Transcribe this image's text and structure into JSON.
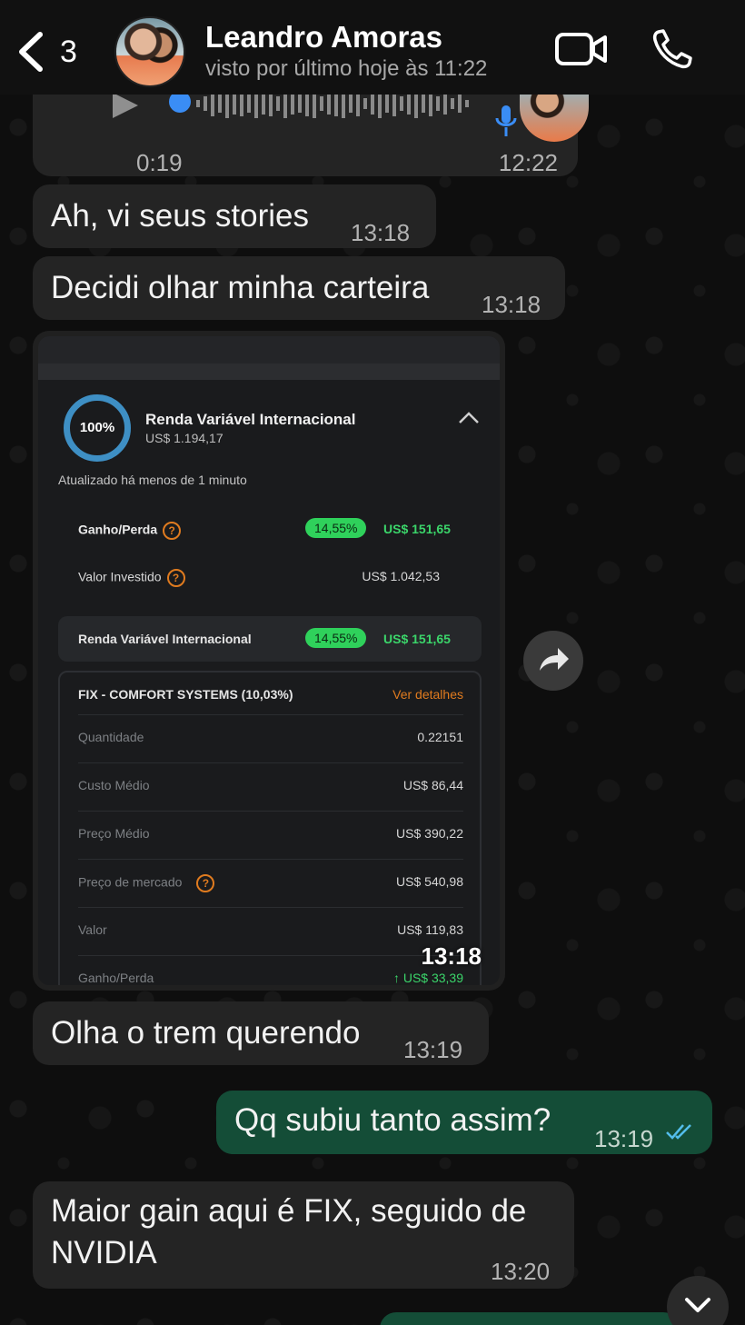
{
  "header": {
    "back_count": "3",
    "contact_name": "Leandro Amoras",
    "status": "visto por último hoje às 11:22"
  },
  "voice_message": {
    "duration": "0:19",
    "time": "12:22"
  },
  "messages": [
    {
      "text": "Ah, vi seus stories",
      "time": "13:18",
      "direction": "in"
    },
    {
      "text": "Decidi olhar minha carteira",
      "time": "13:18",
      "direction": "in"
    },
    {
      "text": "Olha o trem querendo",
      "time": "13:19",
      "direction": "in"
    },
    {
      "text": "Qq subiu tanto assim?",
      "time": "13:19",
      "direction": "out"
    },
    {
      "text": "Maior gain aqui é FIX, seguido de NVIDIA",
      "time": "13:20",
      "direction": "in"
    }
  ],
  "screenshot": {
    "time": "13:18",
    "ring_pct": "100%",
    "title": "Renda Variável Internacional",
    "total": "US$ 1.194,17",
    "updated": "Atualizado há menos de 1 minuto",
    "gain_label": "Ganho/Perda",
    "gain_pct": "14,55%",
    "gain_val": "US$ 151,65",
    "invested_label": "Valor Investido",
    "invested_val": "US$ 1.042,53",
    "summary_label": "Renda Variável Internacional",
    "summary_pct": "14,55%",
    "summary_val": "US$ 151,65",
    "detail_title": "FIX - COMFORT SYSTEMS (10,03%)",
    "detail_link": "Ver detalhes",
    "rows": [
      {
        "label": "Quantidade",
        "value": "0.22151"
      },
      {
        "label": "Custo Médio",
        "value": "US$ 86,44"
      },
      {
        "label": "Preço Médio",
        "value": "US$ 390,22"
      },
      {
        "label": "Preço de mercado",
        "value": "US$ 540,98"
      },
      {
        "label": "Valor",
        "value": "US$ 119,83"
      },
      {
        "label": "Ganho/Perda",
        "value": "↑ US$ 33,39"
      }
    ]
  },
  "colors": {
    "incoming_bubble": "#242424",
    "outgoing_bubble": "#144d37",
    "read_ticks": "#53bdeb",
    "accent_green": "#2fd15b",
    "accent_orange": "#e07b1f"
  }
}
